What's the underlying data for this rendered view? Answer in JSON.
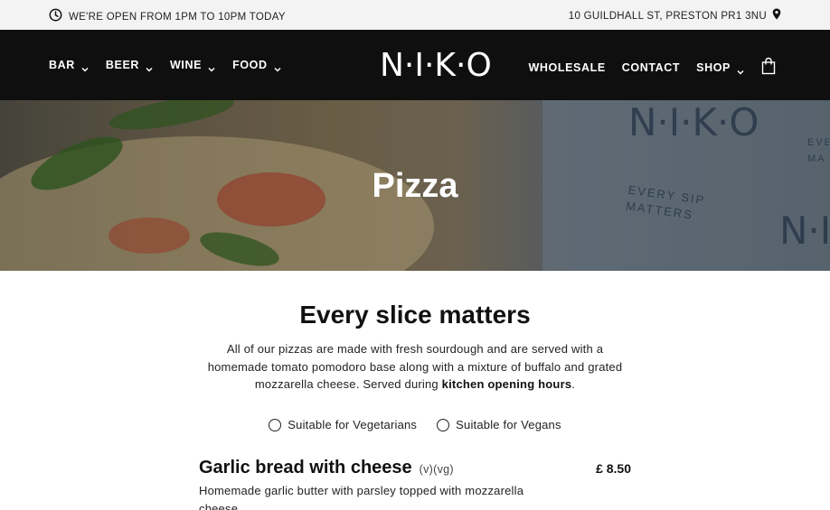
{
  "topbar": {
    "hours": "WE'RE OPEN FROM 1PM TO 10PM TODAY",
    "address": "10 GUILDHALL ST, PRESTON PR1 3NU"
  },
  "nav": {
    "logo": "N·I·K·O",
    "left": [
      {
        "label": "BAR"
      },
      {
        "label": "BEER"
      },
      {
        "label": "WINE"
      },
      {
        "label": "FOOD"
      }
    ],
    "right": [
      {
        "label": "WHOLESALE"
      },
      {
        "label": "CONTACT"
      },
      {
        "label": "SHOP"
      }
    ]
  },
  "hero": {
    "title": "Pizza",
    "mark": "N·I·K·O",
    "mark_partial": "N·I",
    "motto": "EVERY SIP MATTERS",
    "motto_partial": "EVERY MA"
  },
  "section": {
    "heading": "Every slice matters",
    "intro_text": "All of our pizzas are made with fresh sourdough and are served with a homemade tomato pomodoro base along with a mixture of buffalo and grated mozzarella cheese. Served during ",
    "intro_link": "kitchen opening hours",
    "intro_end": "."
  },
  "legend": [
    {
      "label": "Suitable for Vegetarians"
    },
    {
      "label": "Suitable for Vegans"
    }
  ],
  "menu": [
    {
      "name": "Garlic bread with cheese",
      "tags": "(v)(vg)",
      "price": "£ 8.50",
      "description": "Homemade garlic butter with parsley topped with mozzarella cheese"
    }
  ],
  "colors": {
    "nav_bg": "#0f0f0f",
    "topbar_bg": "#f3f3f3",
    "text": "#111111"
  }
}
